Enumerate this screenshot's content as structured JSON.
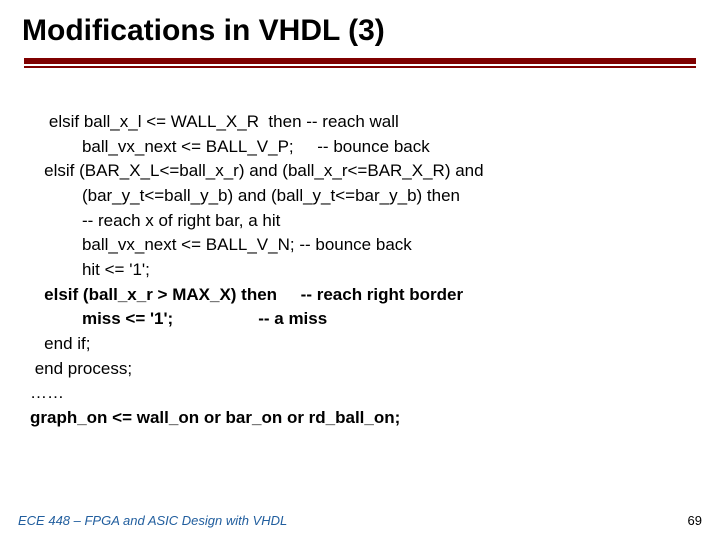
{
  "title": "Modifications in VHDL (3)",
  "code": {
    "l01": "    elsif ball_x_l <= WALL_X_R  then -- reach wall",
    "l02": "           ball_vx_next <= BALL_V_P;     -- bounce back",
    "l03": "   elsif (BAR_X_L<=ball_x_r) and (ball_x_r<=BAR_X_R) and",
    "l04": "           (bar_y_t<=ball_y_b) and (ball_y_t<=bar_y_b) then",
    "l05": "           -- reach x of right bar, a hit",
    "l06": "           ball_vx_next <= BALL_V_N; -- bounce back",
    "l07": "           hit <= '1';",
    "l08": "   elsif (ball_x_r > MAX_X) then     -- reach right border",
    "l09": "           miss <= '1';                  -- a miss",
    "l10": "   end if;",
    "l11": " end process;",
    "l12": "……",
    "l13": "graph_on <= wall_on or bar_on or rd_ball_on;"
  },
  "footer": {
    "left": "ECE 448 – FPGA and ASIC Design with VHDL",
    "page": "69"
  }
}
